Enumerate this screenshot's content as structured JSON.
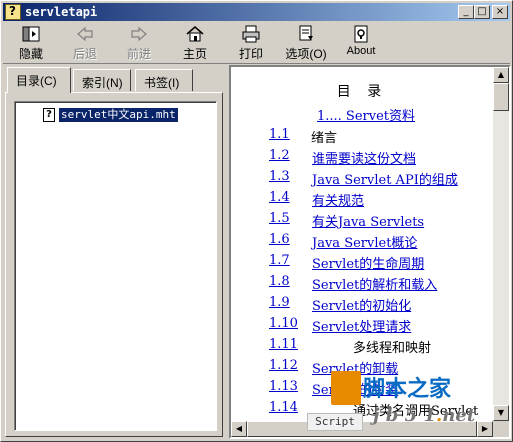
{
  "window": {
    "title": "servletapi",
    "controls": {
      "minimize": "_",
      "maximize": "□",
      "close": "×"
    }
  },
  "toolbar": {
    "hide": {
      "label": "隐藏",
      "icon": "hide-icon"
    },
    "back": {
      "label": "后退",
      "icon": "back-arrow-icon",
      "enabled": false
    },
    "forward": {
      "label": "前进",
      "icon": "forward-arrow-icon",
      "enabled": false
    },
    "home": {
      "label": "主页",
      "icon": "home-icon"
    },
    "print": {
      "label": "打印",
      "icon": "print-icon"
    },
    "options": {
      "label": "选项(O)",
      "icon": "options-icon"
    },
    "about": {
      "label": "About",
      "icon": "about-icon"
    }
  },
  "tabs": [
    {
      "label": "目录(C)",
      "active": true
    },
    {
      "label": "索引(N)",
      "active": false
    },
    {
      "label": "书签(I)",
      "active": false
    }
  ],
  "tree": {
    "items": [
      {
        "label": "servlet中文api.mht",
        "icon": "help-page-icon",
        "selected": true
      }
    ]
  },
  "content": {
    "toc_title": "目 录",
    "chapter": "1.... Servet资料",
    "rows": [
      {
        "num": "1.1",
        "text": "绪言",
        "style": "plain"
      },
      {
        "num": "1.2",
        "text": "谁需要读这份文档",
        "style": "link"
      },
      {
        "num": "1.3",
        "text": "Java Servlet API的组成",
        "style": "link"
      },
      {
        "num": "1.4",
        "text": "有关规范",
        "style": "link"
      },
      {
        "num": "1.5",
        "text": "有关Java Servlets",
        "style": "link"
      },
      {
        "num": "1.6",
        "text": "Java Servlet概论",
        "style": "link"
      },
      {
        "num": "1.7",
        "text": "Servlet的生命周期",
        "style": "link"
      },
      {
        "num": "1.8",
        "text": "Servlet的解析和载入",
        "style": "link"
      },
      {
        "num": "1.9",
        "text": "Servlet的初始化",
        "style": "link"
      },
      {
        "num": "1.10",
        "text": "Servlet处理请求",
        "style": "link"
      },
      {
        "num": "1.11",
        "text": "多线程和映射",
        "style": "indent"
      },
      {
        "num": "1.12",
        "text": "Servlet的卸载",
        "style": "link"
      },
      {
        "num": "1.13",
        "text": "Servlet的封装",
        "style": "link"
      },
      {
        "num": "1.14",
        "text": "通过类名调用Servlet",
        "style": "indent"
      }
    ]
  },
  "watermark": {
    "site": "脚本之家",
    "url_parts": [
      "j",
      "b",
      "5",
      "1",
      ".",
      "n",
      "e",
      "t"
    ],
    "badge": "Script"
  }
}
